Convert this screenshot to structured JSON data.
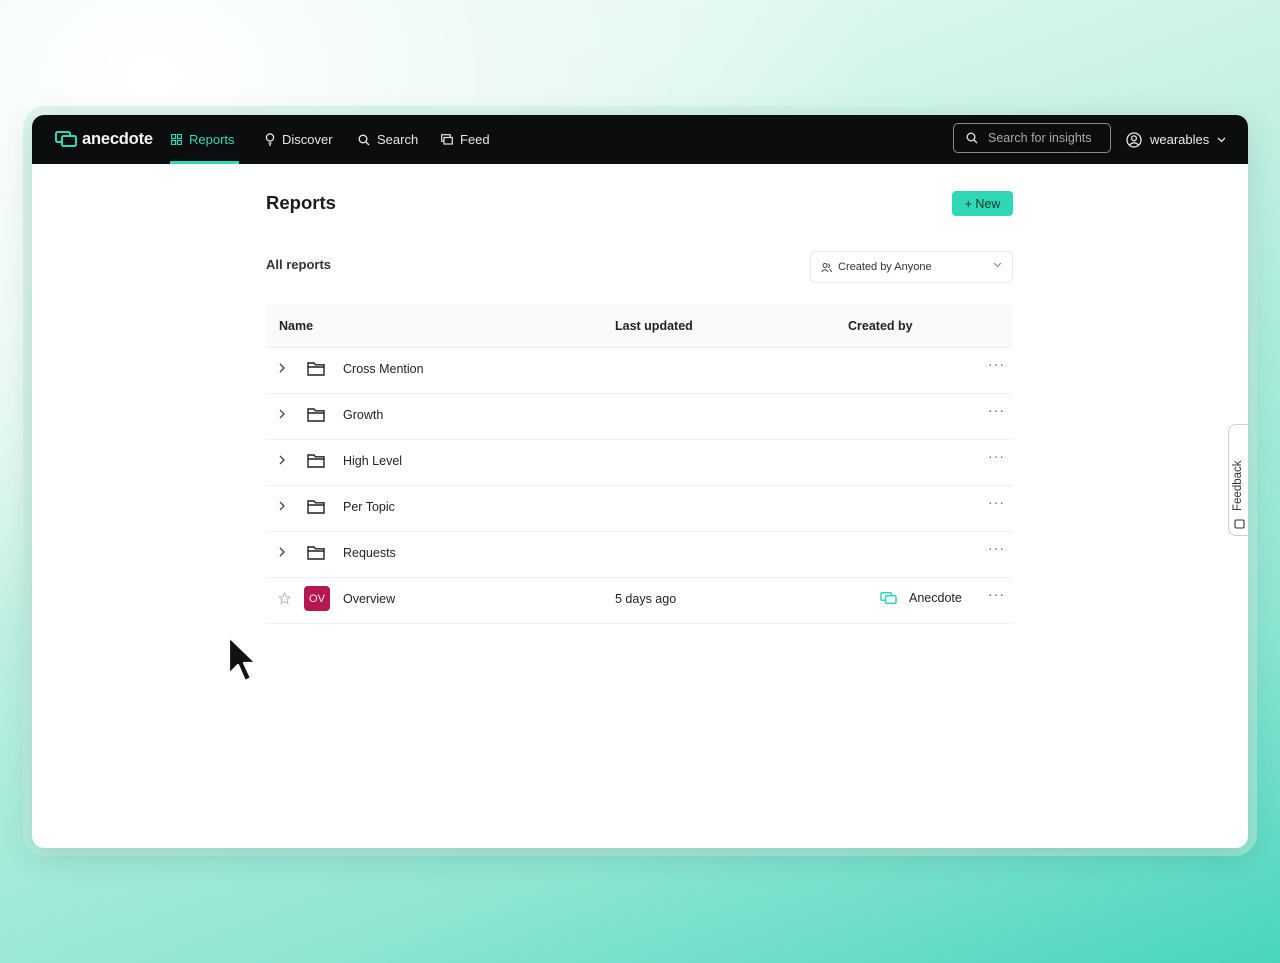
{
  "app": {
    "logo_text": "anecdote",
    "nav": [
      {
        "label": "Reports",
        "icon": "reports-icon",
        "active": true
      },
      {
        "label": "Discover",
        "icon": "lightbulb-icon",
        "active": false
      },
      {
        "label": "Search",
        "icon": "search-icon",
        "active": false
      },
      {
        "label": "Feed",
        "icon": "feed-icon",
        "active": false
      }
    ],
    "search": {
      "placeholder": "Search for insights",
      "value": ""
    },
    "workspace": {
      "label": "wearables"
    },
    "accent_color": "#2ed8b6"
  },
  "page": {
    "title": "Reports",
    "new_button": "+ New",
    "section_label": "All reports",
    "filter": {
      "label": "Created by Anyone"
    }
  },
  "table": {
    "columns": [
      "Name",
      "Last updated",
      "Created by"
    ],
    "rows": [
      {
        "type": "folder",
        "name": "Cross Mention",
        "updated": "",
        "creator": "",
        "more": "···"
      },
      {
        "type": "folder",
        "name": "Growth",
        "updated": "",
        "creator": "",
        "more": "···"
      },
      {
        "type": "folder",
        "name": "High Level",
        "updated": "",
        "creator": "",
        "more": "···"
      },
      {
        "type": "folder",
        "name": "Per Topic",
        "updated": "",
        "creator": "",
        "more": "···"
      },
      {
        "type": "folder",
        "name": "Requests",
        "updated": "",
        "creator": "",
        "more": "···"
      },
      {
        "type": "report",
        "badge": "OV",
        "badge_color": "#b5184f",
        "name": "Overview",
        "updated": "5 days ago",
        "creator": "Anecdote",
        "more": "···"
      }
    ]
  },
  "feedback": {
    "label": "Feedback"
  }
}
